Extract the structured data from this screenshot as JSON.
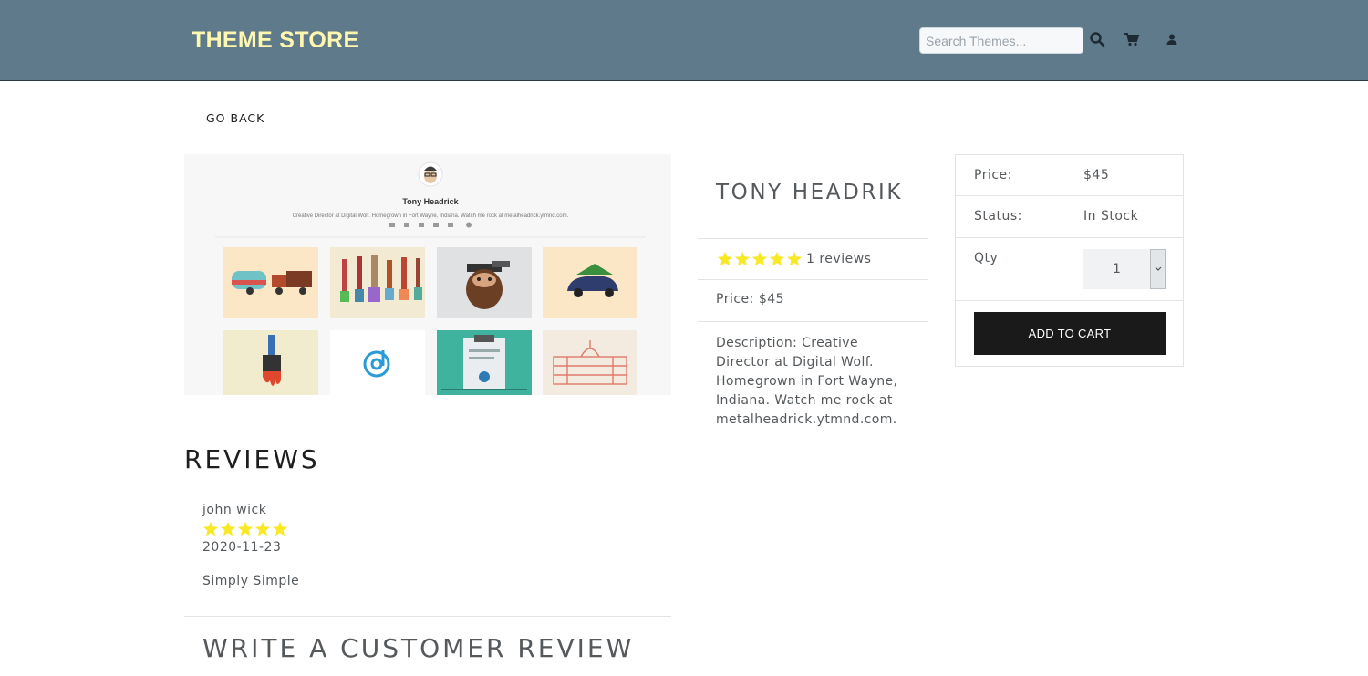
{
  "header": {
    "brand": "THEME STORE",
    "search_placeholder": "Search Themes...",
    "search_value": "",
    "icons": {
      "search": "search-icon",
      "cart": "cart-icon",
      "user": "user-icon"
    }
  },
  "nav": {
    "go_back": "GO BACK"
  },
  "theme_preview": {
    "name": "Tony Headrick",
    "tagline": "Creative Director at Digital Wolf. Homegrown in Fort Wayne, Indiana. Watch me rock at metalheadrick.ytmnd.com."
  },
  "product": {
    "title": "TONY HEADRIK",
    "rating": 5,
    "reviews_label": "1 reviews",
    "price_label": "Price: $45",
    "description": "Description: Creative Director at Digital Wolf. Homegrown in Fort Wayne, Indiana. Watch me rock at metalheadrick.ytmnd.com."
  },
  "cart": {
    "price_label": "Price:",
    "price_value": "$45",
    "status_label": "Status:",
    "status_value": "In Stock",
    "qty_label": "Qty",
    "qty_value": "1",
    "add_button": "ADD TO CART"
  },
  "reviews": {
    "heading": "REVIEWS",
    "items": [
      {
        "name": "john wick",
        "rating": 5,
        "date": "2020-11-23",
        "comment": "Simply Simple"
      }
    ],
    "write_heading": "WRITE A CUSTOMER REVIEW"
  },
  "colors": {
    "navbar": "#5f7a8a",
    "brand": "#fff7b0",
    "star": "#f8e825",
    "button": "#1a1a1a",
    "text": "#55595c"
  }
}
